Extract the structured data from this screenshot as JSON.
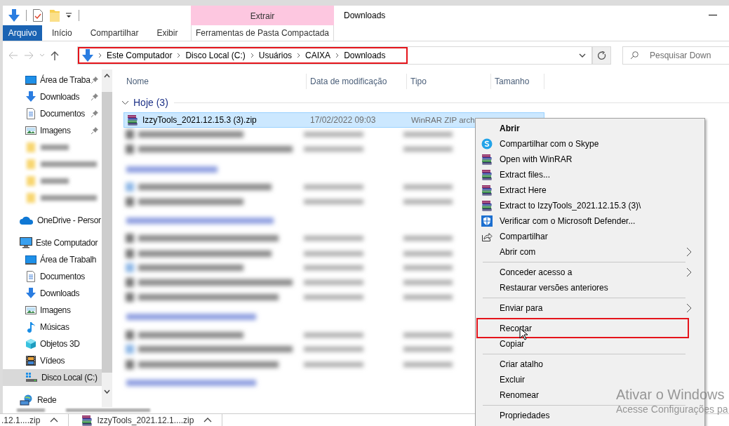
{
  "window": {
    "title": "Downloads"
  },
  "ribbon": {
    "context_header": "Extrair",
    "tabs": [
      {
        "label": "Arquivo",
        "kind": "file",
        "selected": false
      },
      {
        "label": "Início",
        "kind": "tab",
        "selected": false
      },
      {
        "label": "Compartilhar",
        "kind": "tab",
        "selected": false
      },
      {
        "label": "Exibir",
        "kind": "tab",
        "selected": false
      },
      {
        "label": "Ferramentas de Pasta Compactada",
        "kind": "contextual",
        "selected": false
      }
    ]
  },
  "address_bar": {
    "path": [
      "Este Computador",
      "Disco Local (C:)",
      "Usuários",
      "CAIXA",
      "Downloads"
    ],
    "annotated": true
  },
  "search": {
    "placeholder": "Pesquisar Down"
  },
  "sidebar": {
    "quick_access": [
      {
        "label": "Área de Traba",
        "kind": "desktop",
        "pinned": true
      },
      {
        "label": "Downloads",
        "kind": "downloads",
        "pinned": true
      },
      {
        "label": "Documentos",
        "kind": "documents",
        "pinned": true
      },
      {
        "label": "Imagens",
        "kind": "pictures",
        "pinned": true
      }
    ],
    "tree": [
      {
        "label": "OneDrive - Persor",
        "kind": "cloud",
        "selected": false
      },
      {
        "label": "Este Computador",
        "kind": "computer",
        "selected": false,
        "children": [
          {
            "label": "Área de Trabalh",
            "kind": "desktop",
            "selected": false
          },
          {
            "label": "Documentos",
            "kind": "documents",
            "selected": false
          },
          {
            "label": "Downloads",
            "kind": "downloads",
            "selected": false
          },
          {
            "label": "Imagens",
            "kind": "pictures",
            "selected": false
          },
          {
            "label": "Músicas",
            "kind": "music",
            "selected": false
          },
          {
            "label": "Objetos 3D",
            "kind": "cube",
            "selected": false
          },
          {
            "label": "Vídeos",
            "kind": "videos",
            "selected": false
          },
          {
            "label": "Disco Local (C:)",
            "kind": "disk",
            "selected": true
          }
        ]
      },
      {
        "label": "Rede",
        "kind": "network",
        "selected": false
      }
    ]
  },
  "file_list": {
    "columns": [
      "Nome",
      "Data de modificação",
      "Tipo",
      "Tamanho"
    ],
    "groups": [
      {
        "label": "Hoje (3)",
        "rows": [
          {
            "name": "IzzyTools_2021.12.15.3 (3).zip",
            "date": "17/02/2022 09:03",
            "type": "WinRAR ZIP arch",
            "selected": true
          }
        ]
      }
    ]
  },
  "context_menu": {
    "items": [
      {
        "kind": "plain",
        "label": "Abrir",
        "bold": true,
        "submenu": false,
        "annotated": false
      },
      {
        "kind": "skype",
        "label": "Compartilhar com o Skype",
        "bold": false,
        "submenu": false,
        "annotated": false
      },
      {
        "kind": "winrar",
        "label": "Open with WinRAR",
        "bold": false,
        "submenu": false,
        "annotated": false
      },
      {
        "kind": "winrar",
        "label": "Extract files...",
        "bold": false,
        "submenu": false,
        "annotated": false
      },
      {
        "kind": "winrar",
        "label": "Extract Here",
        "bold": false,
        "submenu": false,
        "annotated": false
      },
      {
        "kind": "winrar",
        "label": "Extract to IzzyTools_2021.12.15.3 (3)\\",
        "bold": false,
        "submenu": false,
        "annotated": false
      },
      {
        "kind": "defender",
        "label": "Verificar com o Microsoft Defender...",
        "bold": false,
        "submenu": false,
        "annotated": false
      },
      {
        "kind": "share",
        "label": "Compartilhar",
        "bold": false,
        "submenu": false,
        "annotated": false
      },
      {
        "kind": "plain",
        "label": "Abrir com",
        "bold": false,
        "submenu": true,
        "annotated": false
      },
      {
        "kind": "separator"
      },
      {
        "kind": "plain",
        "label": "Conceder acesso a",
        "bold": false,
        "submenu": true,
        "annotated": false
      },
      {
        "kind": "plain",
        "label": "Restaurar versões anteriores",
        "bold": false,
        "submenu": false,
        "annotated": false
      },
      {
        "kind": "separator"
      },
      {
        "kind": "plain",
        "label": "Enviar para",
        "bold": false,
        "submenu": true,
        "annotated": false
      },
      {
        "kind": "separator"
      },
      {
        "kind": "plain",
        "label": "Recortar",
        "bold": false,
        "submenu": false,
        "annotated": true
      },
      {
        "kind": "plain",
        "label": "Copiar",
        "bold": false,
        "submenu": false,
        "annotated": false
      },
      {
        "kind": "separator"
      },
      {
        "kind": "plain",
        "label": "Criar atalho",
        "bold": false,
        "submenu": false,
        "annotated": false
      },
      {
        "kind": "plain",
        "label": "Excluir",
        "bold": false,
        "submenu": false,
        "annotated": false
      },
      {
        "kind": "plain",
        "label": "Renomear",
        "bold": false,
        "submenu": false,
        "annotated": false
      },
      {
        "kind": "separator"
      },
      {
        "kind": "plain",
        "label": "Propriedades",
        "bold": false,
        "submenu": false,
        "annotated": false
      }
    ]
  },
  "activation_notice": {
    "title": "Ativar o Windows",
    "subtitle": "Acesse Configurações pa"
  },
  "download_bar": {
    "items": [
      {
        "label": ".12.1....zip",
        "kind": "cut"
      },
      {
        "label": "IzzyTools_2021.12.1....zip",
        "kind": "archive"
      }
    ]
  }
}
